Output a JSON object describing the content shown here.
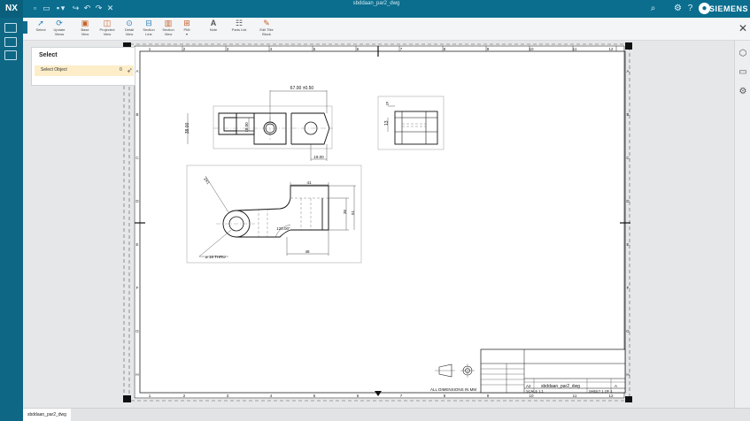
{
  "app": {
    "logo": "NX",
    "title": "sbddaan_par2_dwg",
    "brand": "SIEMENS"
  },
  "ribbon": {
    "buttons": [
      {
        "line1": "Select",
        "line2": ""
      },
      {
        "line1": "Update",
        "line2": "Views"
      },
      {
        "line1": "Base",
        "line2": "View"
      },
      {
        "line1": "Projected",
        "line2": "View"
      },
      {
        "line1": "Detail",
        "line2": "View"
      },
      {
        "line1": "Section",
        "line2": "Line"
      },
      {
        "line1": "Section",
        "line2": "View"
      },
      {
        "line1": "PMI",
        "line2": "▾"
      },
      {
        "line1": "Note",
        "line2": ""
      },
      {
        "line1": "Parts List",
        "line2": ""
      },
      {
        "line1": "Edit Title",
        "line2": "Block"
      }
    ]
  },
  "select_panel": {
    "title": "Select",
    "row_label": "Select Object",
    "row_count": "0"
  },
  "drawing": {
    "columns": [
      "1",
      "2",
      "3",
      "4",
      "5",
      "6",
      "7",
      "8",
      "9",
      "10",
      "11",
      "12"
    ],
    "rows": [
      "A",
      "B",
      "C",
      "D",
      "E",
      "F",
      "G",
      "H"
    ],
    "dims": {
      "top_width": "67.00 ±0.50",
      "height_38": "38.00",
      "height_18": "18.00",
      "width_19": "19.00",
      "right_5": "5",
      "right_13": "13",
      "radius_r": "2X1",
      "w41": "41",
      "h36": "36",
      "h51": "51",
      "angle": "120.00°",
      "w48": "48",
      "hole": "⌀ 18 THRU"
    },
    "notes": {
      "all_dims": "ALL DIMENSIONS IN MM"
    },
    "title_block": {
      "drawing_name": "sbddaan_par2_dwg",
      "size": "A2",
      "scale": "SCALE 1:1",
      "sheet": "SHEET 1 OF 1",
      "revision": "A"
    }
  },
  "tabs": {
    "active": "sbddaan_par2_dwg"
  }
}
